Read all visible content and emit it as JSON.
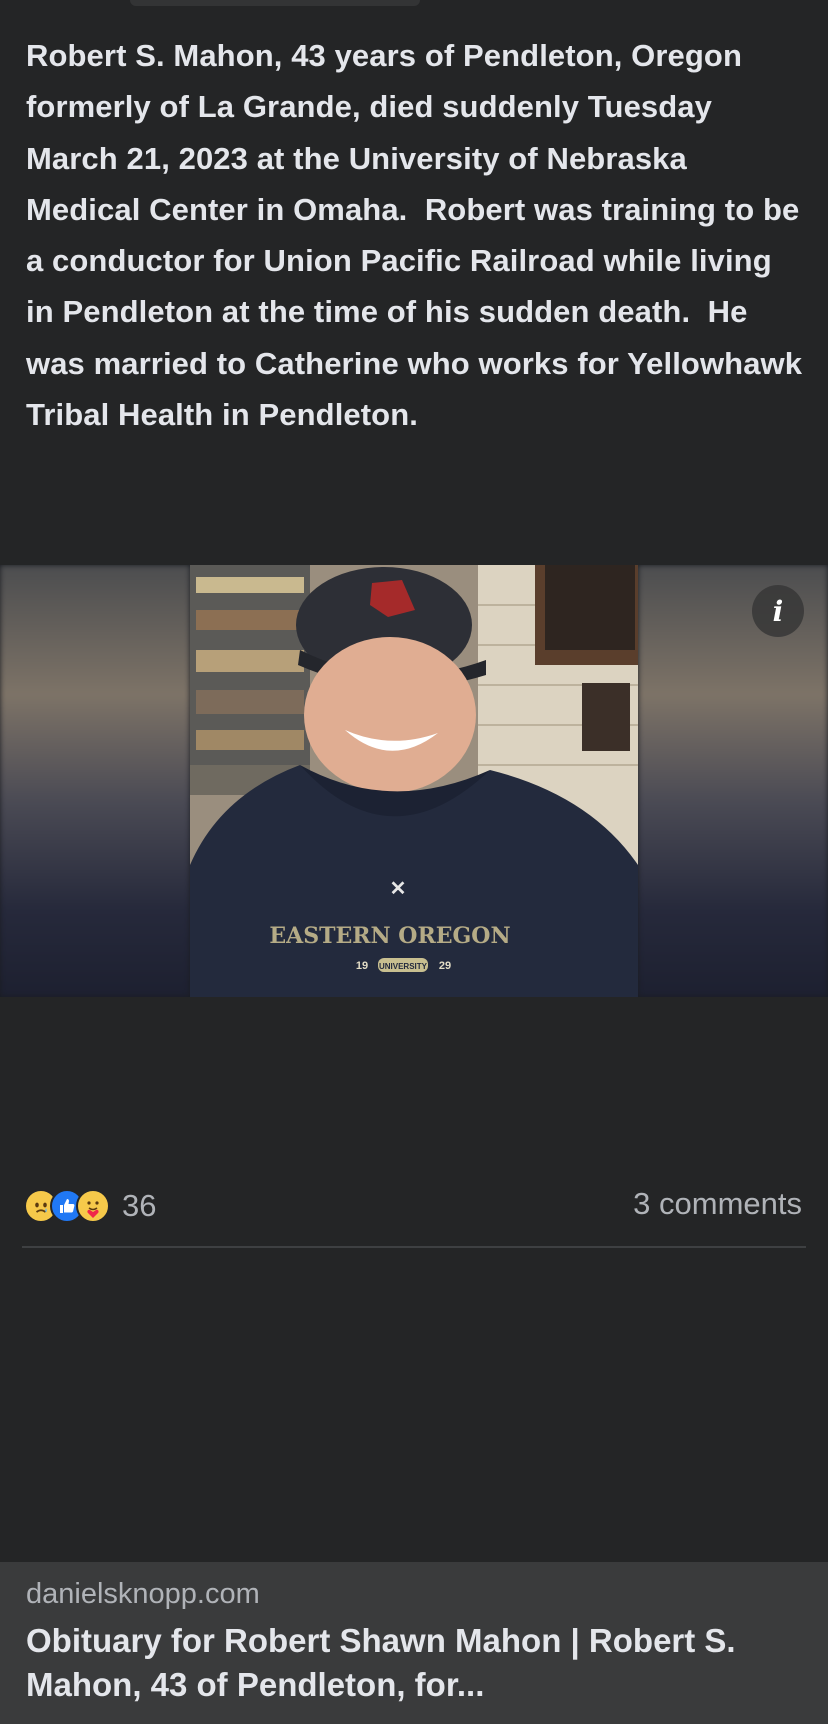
{
  "post": {
    "text": "Robert S. Mahon, 43 years of Pendleton, Oregon formerly of La Grande, died suddenly Tuesday March 21, 2023 at the University of Nebraska Medical Center in Omaha.  Robert was training to be a conductor for Union Pacific Railroad while living in Pendleton at the time of his sudden death.  He was married to Catherine who works for Yellowhawk Tribal Health in Pendleton."
  },
  "link_preview": {
    "domain": "danielsknopp.com",
    "title": "Obituary for Robert Shawn Mahon | Robert S. Mahon, 43 of Pendleton, for...",
    "info_icon": "i",
    "sweatshirt_text": "EASTERN OREGON",
    "sweatshirt_year_left": "19",
    "sweatshirt_year_right": "29",
    "sweatshirt_sub": "UNIVERSITY"
  },
  "engagement": {
    "reaction_icons": [
      "sad-icon",
      "like-icon",
      "care-icon"
    ],
    "reaction_count": "36",
    "comments": "3 comments"
  },
  "colors": {
    "background": "#242526",
    "card_meta": "#3a3b3c",
    "text_primary": "#e4e6eb",
    "text_secondary": "#b0b3b8",
    "like_blue": "#2078f4"
  }
}
